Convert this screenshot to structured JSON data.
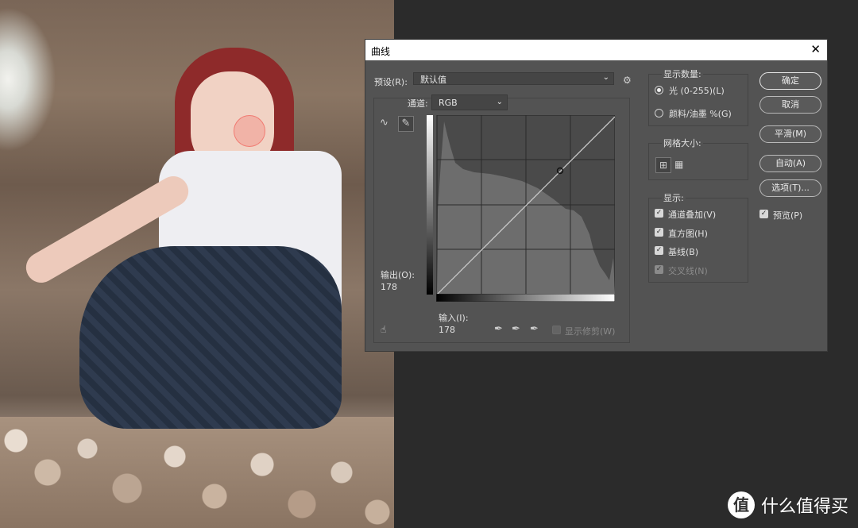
{
  "dialog": {
    "title": "曲线",
    "close": "✕",
    "preset_label": "预设(R):",
    "preset_value": "默认值",
    "channel_label": "通道:",
    "channel_value": "RGB",
    "output_label": "输出(O):",
    "output_value": "178",
    "input_label": "输入(I):",
    "input_value": "178",
    "show_clipping": "显示修剪(W)",
    "display_amount": {
      "title": "显示数量:",
      "light": "光 (0-255)(L)",
      "pigment": "颜料/油墨 %(G)"
    },
    "grid_size_title": "网格大小:",
    "show": {
      "title": "显示:",
      "channel_overlays": "通道叠加(V)",
      "histogram": "直方图(H)",
      "baseline": "基线(B)",
      "intersection": "交叉线(N)"
    },
    "buttons": {
      "ok": "确定",
      "cancel": "取消",
      "smooth": "平滑(M)",
      "auto": "自动(A)",
      "options": "选项(T)...",
      "preview": "预览(P)"
    }
  },
  "watermark": {
    "mark": "值",
    "text": "什么值得买"
  }
}
